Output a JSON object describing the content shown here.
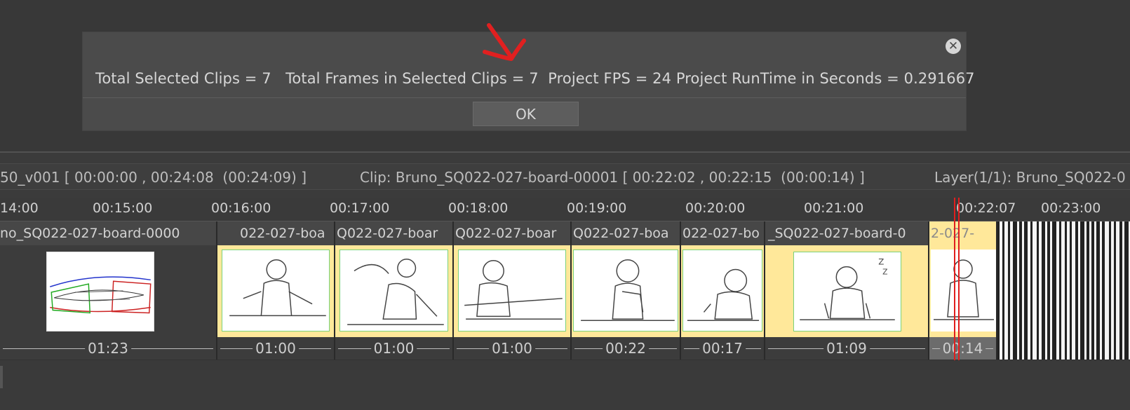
{
  "dialog": {
    "message": "Total Selected Clips = 7   Total Frames in Selected Clips = 7  Project FPS = 24 Project RunTime in Seconds = 0.291667",
    "ok_label": "OK",
    "close_icon": "close-icon"
  },
  "annotation": {
    "color": "#e02020",
    "icon": "hand-drawn-arrow-icon"
  },
  "info_bar": {
    "sequence": "50_v001 [ 00:00:00 , 00:24:08  (00:24:09) ]",
    "clip": "Clip: Bruno_SQ022-027-board-00001 [ 00:22:02 , 00:22:15  (00:00:14) ]",
    "layer": "Layer(1/1): Bruno_SQ022-0"
  },
  "ruler": {
    "labels": [
      "14:00",
      "00:15:00",
      "00:16:00",
      "00:17:00",
      "00:18:00",
      "00:19:00",
      "00:20:00",
      "00:21:00",
      "00:22:07",
      "00:23:00"
    ]
  },
  "clips": [
    {
      "name": "no_SQ022-027-board-0000",
      "duration": "01:23",
      "selected": false
    },
    {
      "name": "022-027-boa",
      "duration": "01:00",
      "selected": true
    },
    {
      "name": "Q022-027-boar",
      "duration": "01:00",
      "selected": true
    },
    {
      "name": "Q022-027-boar",
      "duration": "01:00",
      "selected": true
    },
    {
      "name": "Q022-027-boa",
      "duration": "00:22",
      "selected": true
    },
    {
      "name": "022-027-bo",
      "duration": "00:17",
      "selected": true
    },
    {
      "name": "_SQ022-027-board-0",
      "duration": "01:09",
      "selected": true
    },
    {
      "name": "2-027-",
      "duration": "00:14",
      "selected": true
    }
  ],
  "colors": {
    "selection": "#ffe89a",
    "playhead": "#e01e1e",
    "thumb_border": "#7ad27a"
  }
}
